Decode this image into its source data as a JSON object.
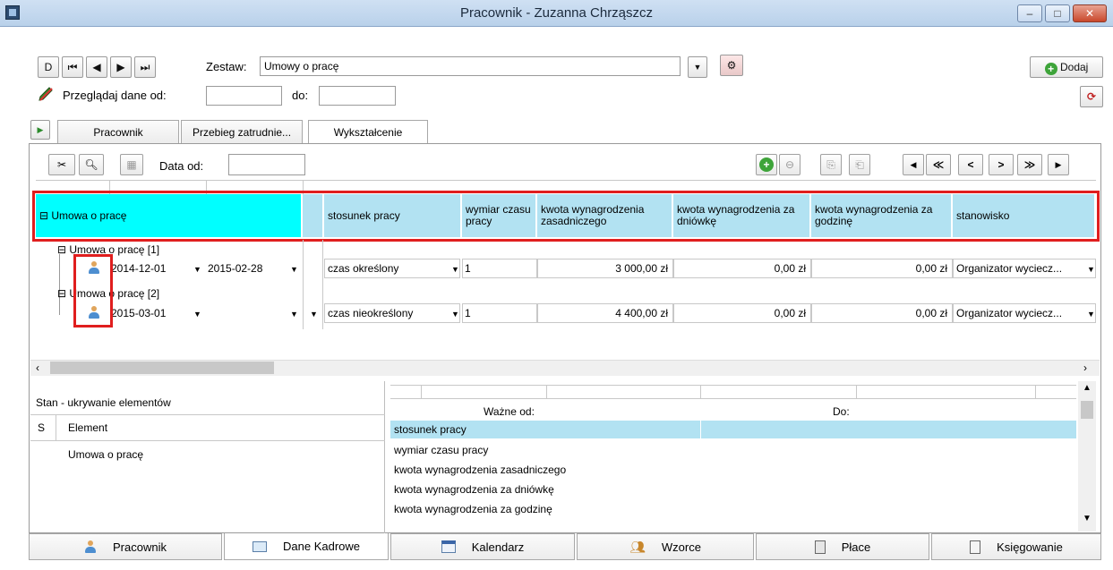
{
  "window": {
    "title": "Pracownik - Zuzanna Chrząszcz",
    "minimize": "–",
    "maximize": "□",
    "close": "✕"
  },
  "toolbar": {
    "nav": [
      "D",
      "⏮",
      "◀",
      "▶",
      "⏭"
    ],
    "zestaw_label": "Zestaw:",
    "zestaw_value": "Umowy o pracę",
    "dodaj_label": "Dodaj",
    "browse_label": "Przeglądaj dane od:",
    "do_label": "do:",
    "from_value": "",
    "to_value": ""
  },
  "tabs": [
    {
      "label": "Pracownik"
    },
    {
      "label": "Przebieg zatrudnie..."
    },
    {
      "label": "Wykształcenie"
    }
  ],
  "panel_toolbar": {
    "data_od_label": "Data od:",
    "data_od_value": "",
    "nav": [
      "◀",
      "≪",
      "<",
      ">",
      "≫",
      "▶"
    ]
  },
  "grid": {
    "group_header": "⊟ Umowa o pracę",
    "columns": [
      {
        "label": "stosunek pracy"
      },
      {
        "label": "wymiar czasu pracy"
      },
      {
        "label": "kwota wynagrodzenia zasadniczego"
      },
      {
        "label": "kwota wynagrodzenia za dniówkę"
      },
      {
        "label": "kwota wynagrodzenia za godzinę"
      },
      {
        "label": "stanowisko"
      }
    ],
    "rows": [
      {
        "node": "⊟ Umowa o pracę [1]",
        "from": "2014-12-01",
        "to": "2015-02-28",
        "stosunek": "czas określony",
        "wymiar": "1",
        "zasadnicze": "3 000,00 zł",
        "dniowka": "0,00 zł",
        "godzina": "0,00 zł",
        "stanowisko": "Organizator wyciecz..."
      },
      {
        "node": "⊟ Umowa o pracę [2]",
        "from": "2015-03-01",
        "to": "",
        "stosunek": "czas nieokreślony",
        "wymiar": "1",
        "zasadnicze": "4 400,00 zł",
        "dniowka": "0,00 zł",
        "godzina": "0,00 zł",
        "stanowisko": "Organizator wyciecz..."
      }
    ]
  },
  "lower": {
    "stan_title": "Stan - ukrywanie elementów",
    "s_col": "S",
    "element_col": "Element",
    "element_value": "Umowa o pracę",
    "wazne_od": "Ważne od:",
    "do": "Do:",
    "items": [
      "stosunek pracy",
      "wymiar czasu pracy",
      "kwota wynagrodzenia zasadniczego",
      "kwota wynagrodzenia za dniówkę",
      "kwota wynagrodzenia za godzinę"
    ]
  },
  "bottom_tabs": [
    {
      "label": "Pracownik",
      "icon": "person-icon"
    },
    {
      "label": "Dane Kadrowe",
      "icon": "card-icon"
    },
    {
      "label": "Kalendarz",
      "icon": "calendar-icon"
    },
    {
      "label": "Wzorce",
      "icon": "people-icon"
    },
    {
      "label": "Płace",
      "icon": "calculator-icon"
    },
    {
      "label": "Księgowanie",
      "icon": "ledger-icon"
    }
  ],
  "colors": {
    "header_cyan": "#00ffff",
    "header_blue": "#b2e2f2",
    "highlight_red": "#e01e1e",
    "selected_row": "#b2e2f2"
  }
}
